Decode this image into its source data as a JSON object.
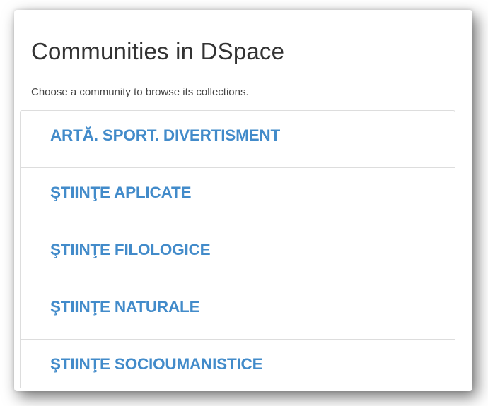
{
  "heading": "Communities in DSpace",
  "subheading": "Choose a community to browse its collections.",
  "communities": [
    {
      "label": "ARTĂ. SPORT. DIVERTISMENT"
    },
    {
      "label": "ŞTIINŢE APLICATE"
    },
    {
      "label": "ŞTIINŢE FILOLOGICE"
    },
    {
      "label": "ŞTIINŢE NATURALE"
    },
    {
      "label": "ŞTIINŢE SOCIOUMANISTICE"
    }
  ],
  "colors": {
    "link": "#428bca",
    "heading": "#333333",
    "border": "#dddddd"
  }
}
